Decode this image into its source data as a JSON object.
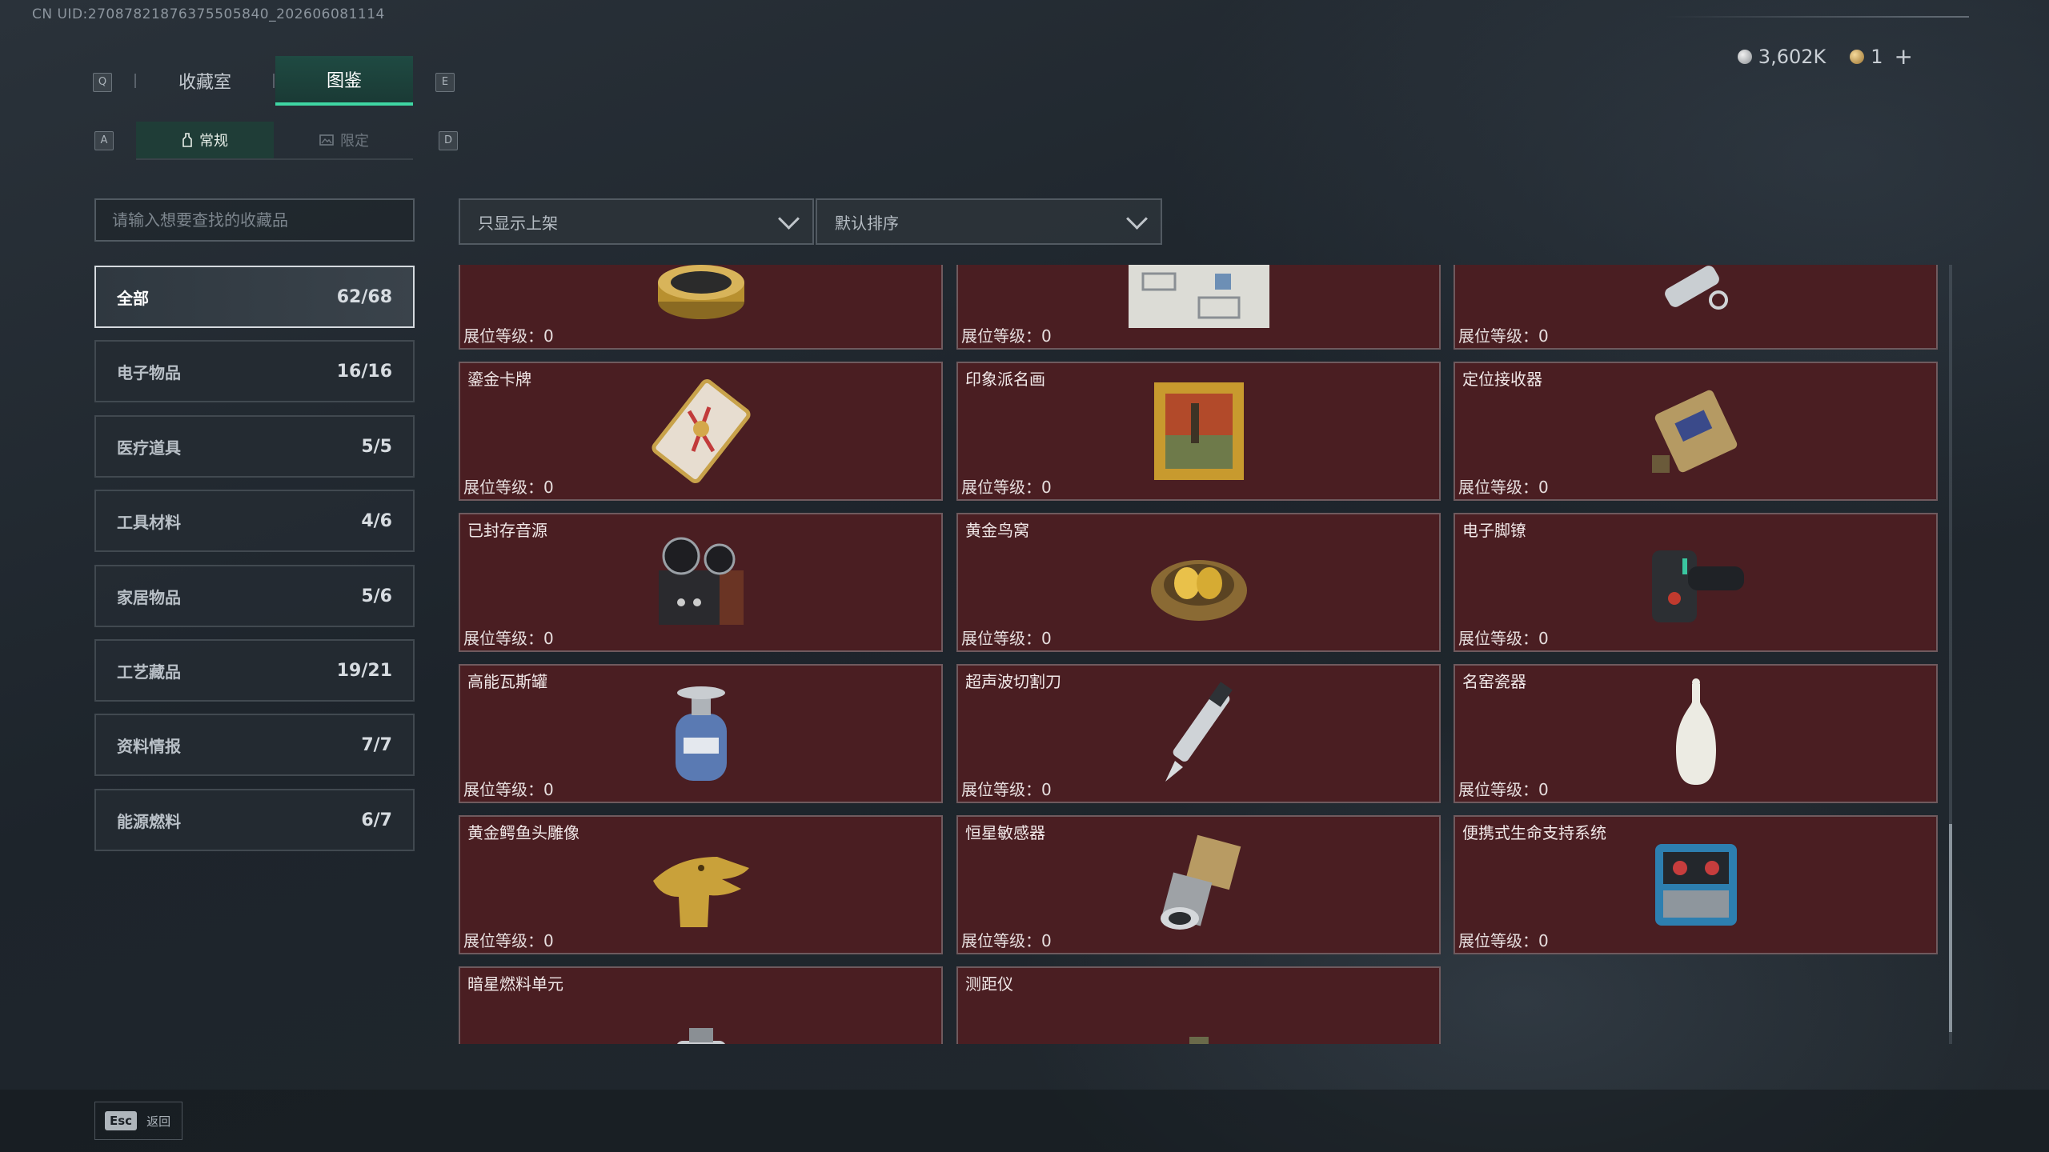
{
  "uid": "CN UID:270878218763755058​40_202606081114",
  "currency": {
    "coins": "3,602K",
    "tickets": "1"
  },
  "tabs": {
    "key_left": "Q",
    "key_right": "E",
    "main": [
      {
        "label": "收藏室"
      },
      {
        "label": "图鉴"
      }
    ],
    "sub_key_left": "A",
    "sub_key_right": "D",
    "sub": [
      {
        "label": "常规"
      },
      {
        "label": "限定"
      }
    ]
  },
  "search": {
    "placeholder": "请输入想要查找的收藏品"
  },
  "filters": {
    "display": "只显示上架",
    "sort": "默认排序"
  },
  "categories": [
    {
      "label": "全部",
      "count": "62/68"
    },
    {
      "label": "电子物品",
      "count": "16/16"
    },
    {
      "label": "医疗道具",
      "count": "5/5"
    },
    {
      "label": "工具材料",
      "count": "4/6"
    },
    {
      "label": "家居物品",
      "count": "5/6"
    },
    {
      "label": "工艺藏品",
      "count": "19/21"
    },
    {
      "label": "资料情报",
      "count": "7/7"
    },
    {
      "label": "能源燃料",
      "count": "6/7"
    }
  ],
  "items": [
    {
      "name": "",
      "level": "展位等级：0",
      "icon": "caviar-tin-icon"
    },
    {
      "name": "",
      "level": "展位等级：0",
      "icon": "map-document-icon"
    },
    {
      "name": "",
      "level": "展位等级：0",
      "icon": "tool-device-icon"
    },
    {
      "name": "鎏金卡牌",
      "level": "展位等级：0",
      "icon": "gilded-card-icon"
    },
    {
      "name": "印象派名画",
      "level": "展位等级：0",
      "icon": "framed-painting-icon"
    },
    {
      "name": "定位接收器",
      "level": "展位等级：0",
      "icon": "gps-receiver-icon"
    },
    {
      "name": "已封存音源",
      "level": "展位等级：0",
      "icon": "tape-recorder-icon"
    },
    {
      "name": "黄金鸟窝",
      "level": "展位等级：0",
      "icon": "golden-nest-icon"
    },
    {
      "name": "电子脚镣",
      "level": "展位等级：0",
      "icon": "electronic-shackle-icon"
    },
    {
      "name": "高能瓦斯罐",
      "level": "展位等级：0",
      "icon": "gas-canister-icon"
    },
    {
      "name": "超声波切割刀",
      "level": "展位等级：0",
      "icon": "ultrasonic-cutter-icon"
    },
    {
      "name": "名窑瓷器",
      "level": "展位等级：0",
      "icon": "porcelain-vase-icon"
    },
    {
      "name": "黄金鳄鱼头雕像",
      "level": "展位等级：0",
      "icon": "gold-crocodile-head-icon"
    },
    {
      "name": "恒星敏感器",
      "level": "展位等级：0",
      "icon": "star-sensor-icon"
    },
    {
      "name": "便携式生命支持系统",
      "level": "展位等级：0",
      "icon": "life-support-icon"
    },
    {
      "name": "暗星燃料单元",
      "level": "",
      "icon": "fuel-cell-icon"
    },
    {
      "name": "测距仪",
      "level": "",
      "icon": "rangefinder-icon"
    }
  ],
  "footer": {
    "esc_key": "Esc",
    "back_label": "返回"
  },
  "colors": {
    "accent": "#3fd6a3",
    "card_bg": "#4a1e22"
  }
}
